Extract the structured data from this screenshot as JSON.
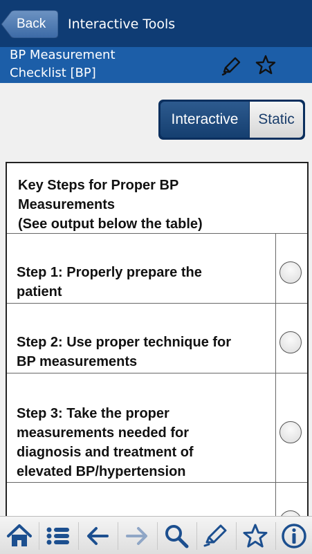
{
  "nav": {
    "back_label": "Back",
    "title": "Interactive Tools"
  },
  "header": {
    "title_line1": "BP Measurement",
    "title_line2": "Checklist [BP]",
    "icons": [
      "pencil-icon",
      "star-icon"
    ]
  },
  "segmented": {
    "options": [
      "Interactive",
      "Static"
    ],
    "selected": "Interactive"
  },
  "table": {
    "header_lines": [
      "Key Steps for Proper BP",
      "Measurements",
      "(See output below the table)"
    ],
    "rows": [
      {
        "lines": [
          "Step 1: Properly prepare the",
          "patient"
        ],
        "checked": false
      },
      {
        "lines": [
          "Step 2: Use proper technique for",
          "BP measurements"
        ],
        "checked": false
      },
      {
        "lines": [
          "Step 3: Take the proper",
          "measurements needed for",
          "diagnosis and treatment of",
          "elevated BP/hypertension"
        ],
        "checked": false
      }
    ]
  },
  "toolbar": {
    "icons": [
      "home-icon",
      "list-icon",
      "back-arrow-icon",
      "forward-arrow-icon",
      "search-icon",
      "pencil-icon",
      "star-icon",
      "info-icon"
    ]
  },
  "colors": {
    "nav_bg": "#0f3c74",
    "subheader_bg": "#1c5ea8",
    "icon_blue": "#1c4f8f"
  }
}
